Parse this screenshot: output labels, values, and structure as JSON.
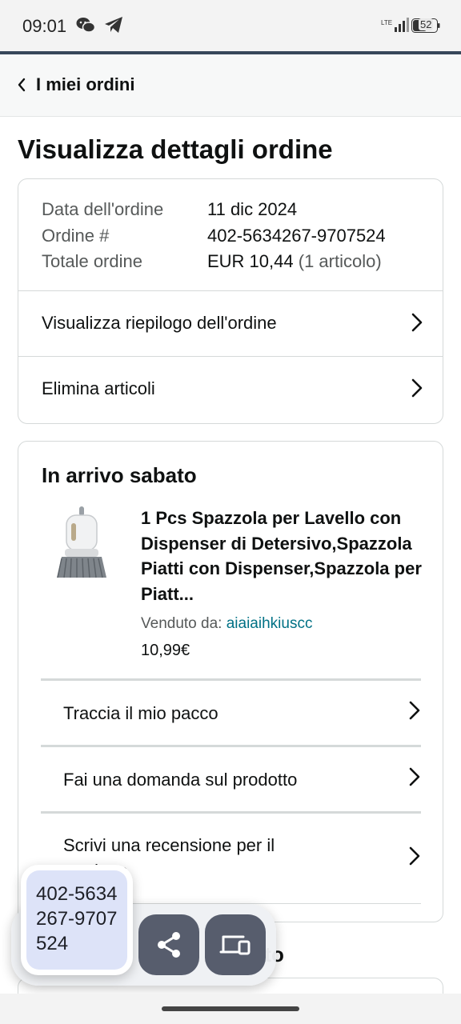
{
  "status_bar": {
    "time": "09:01",
    "battery": "52",
    "network": "LTE"
  },
  "nav": {
    "back_label": "I miei ordini"
  },
  "page": {
    "title": "Visualizza dettagli ordine"
  },
  "order_info": {
    "date_label": "Data dell'ordine",
    "date_value": "11 dic 2024",
    "number_label": "Ordine #",
    "number_value": "402-5634267-9707524",
    "total_label": "Totale ordine",
    "total_value": "EUR 10,44",
    "total_items": "(1 articolo)"
  },
  "order_links": [
    {
      "label": "Visualizza riepilogo dell'ordine"
    },
    {
      "label": "Elimina articoli"
    }
  ],
  "shipment": {
    "status": "In arrivo sabato",
    "product_title": "1 Pcs Spazzola per Lavello con Dispenser di Detersivo,Spazzola Piatti con Dispenser,Spazzola per Piatt...",
    "sold_by_label": "Venduto da:",
    "seller": "aiaiaihkiuscc",
    "price": "10,99€",
    "actions": [
      {
        "label": "Traccia il mio pacco"
      },
      {
        "label": "Fai una domanda sul prodotto"
      },
      {
        "label": "Scrivi una recensione per il prodotto"
      }
    ]
  },
  "next_section": {
    "partial_title": "ento"
  },
  "clipboard_overlay": {
    "copied_text": "402-5634267-9707524"
  },
  "colors": {
    "seller_link": "#007185",
    "overlay_chip": "#dde3f8",
    "overlay_button": "#575d6d"
  }
}
